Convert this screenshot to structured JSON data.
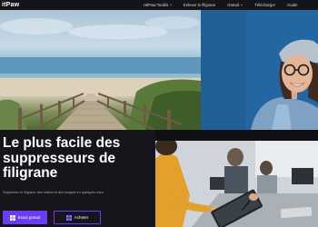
{
  "nav": {
    "logo": "itPaw",
    "items": [
      {
        "label": "HitPaw Toolkit",
        "dropdown": true
      },
      {
        "label": "Enlever le filigrane",
        "dropdown": false
      },
      {
        "label": "Gratuit",
        "dropdown": true
      },
      {
        "label": "Télécharger",
        "dropdown": false
      },
      {
        "label": "Guide",
        "dropdown": false
      }
    ]
  },
  "hero": {
    "headline": "Le plus facile des suppresseurs de filigrane",
    "subtext": "Supprimez le filigrane des vidéos et des images en quelques clics",
    "primary_button": "Essai gratuit",
    "secondary_button": "Acheter"
  },
  "colors": {
    "accent": "#6a3df2",
    "background": "#15151b",
    "nav_background": "#141419"
  },
  "icons": {
    "button_icon": "windows-icon"
  }
}
